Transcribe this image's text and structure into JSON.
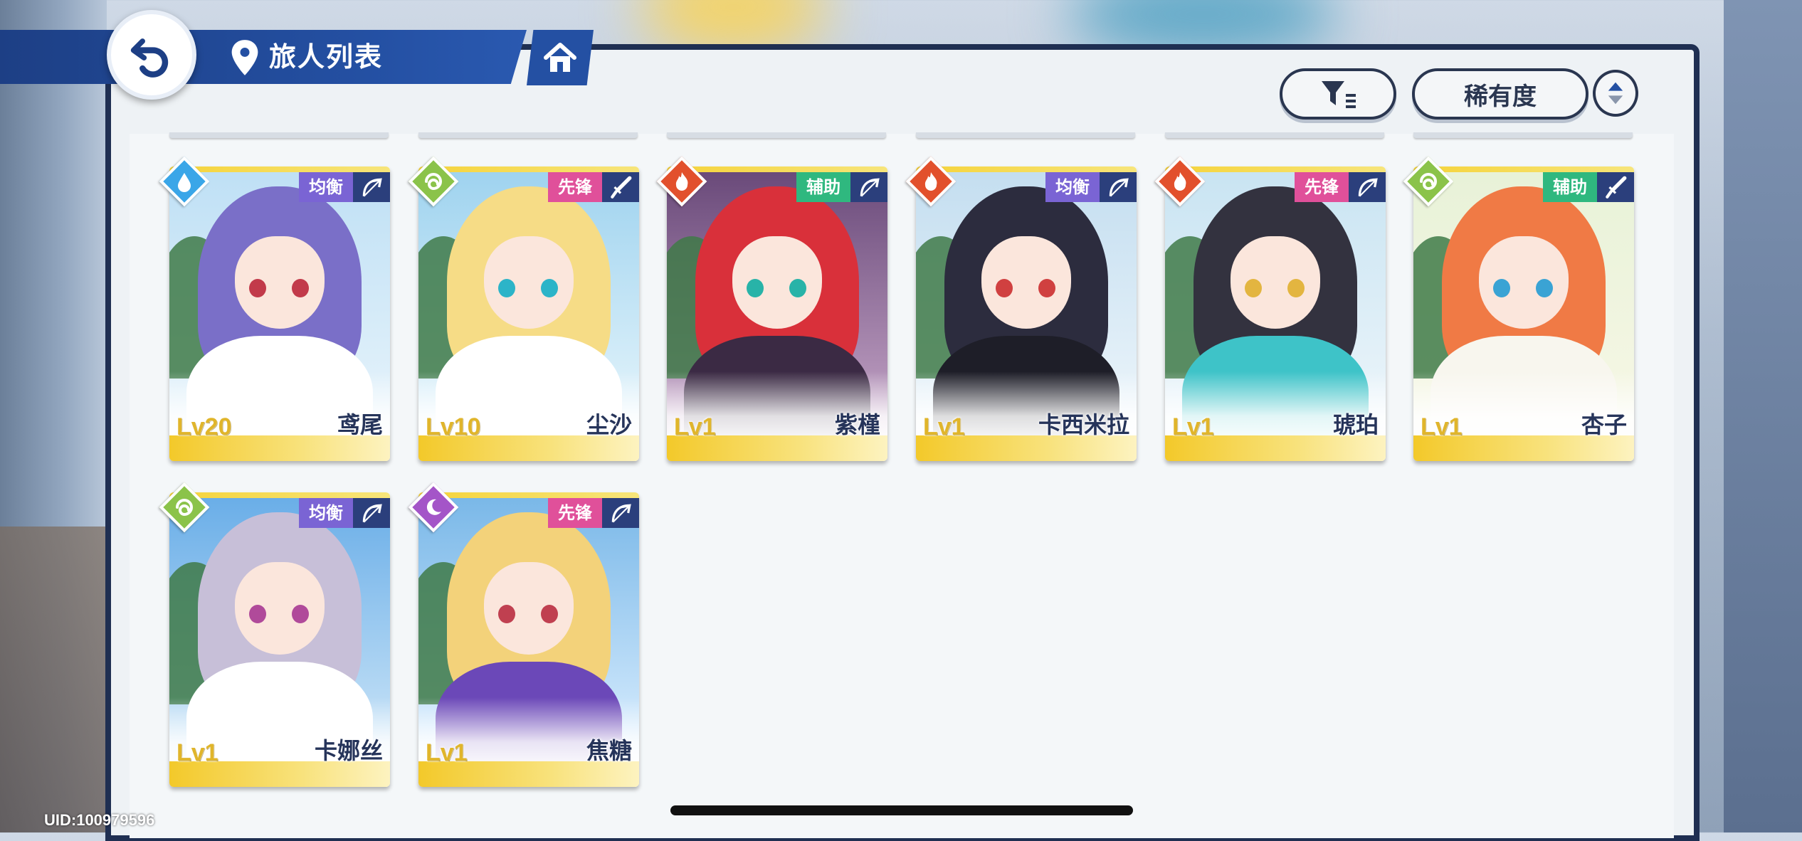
{
  "header": {
    "title": "旅人列表"
  },
  "toolbar": {
    "sort_label": "稀有度"
  },
  "icons": {
    "back": "back-arrow-icon",
    "location": "map-pin-icon",
    "home": "home-icon",
    "filter": "filter-icon",
    "order": "sort-order-icon"
  },
  "element_colors": {
    "water": "#3aa6e8",
    "wind": "#8bc34a",
    "fire": "#e2502c",
    "moon": "#a455c8"
  },
  "role_colors": {
    "均衡": "#7a64d4",
    "先锋": "#e0509a",
    "辅助": "#2fb87f"
  },
  "characters": [
    {
      "name": "鸢尾",
      "level": "Lv20",
      "role": "均衡",
      "element": "water",
      "weapon": "bow-icon"
    },
    {
      "name": "尘沙",
      "level": "Lv10",
      "role": "先锋",
      "element": "wind",
      "weapon": "sword-icon"
    },
    {
      "name": "紫槿",
      "level": "Lv1",
      "role": "辅助",
      "element": "fire",
      "weapon": "bow-icon"
    },
    {
      "name": "卡西米拉",
      "level": "Lv1",
      "role": "均衡",
      "element": "fire",
      "weapon": "bow-icon"
    },
    {
      "name": "琥珀",
      "level": "Lv1",
      "role": "先锋",
      "element": "fire",
      "weapon": "bow-icon"
    },
    {
      "name": "杏子",
      "level": "Lv1",
      "role": "辅助",
      "element": "wind",
      "weapon": "sword-icon"
    },
    {
      "name": "卡娜丝",
      "level": "Lv1",
      "role": "均衡",
      "element": "wind",
      "weapon": "bow-icon"
    },
    {
      "name": "焦糖",
      "level": "Lv1",
      "role": "先锋",
      "element": "moon",
      "weapon": "bow-icon"
    }
  ],
  "footer": {
    "uid": "UID:100979596"
  }
}
